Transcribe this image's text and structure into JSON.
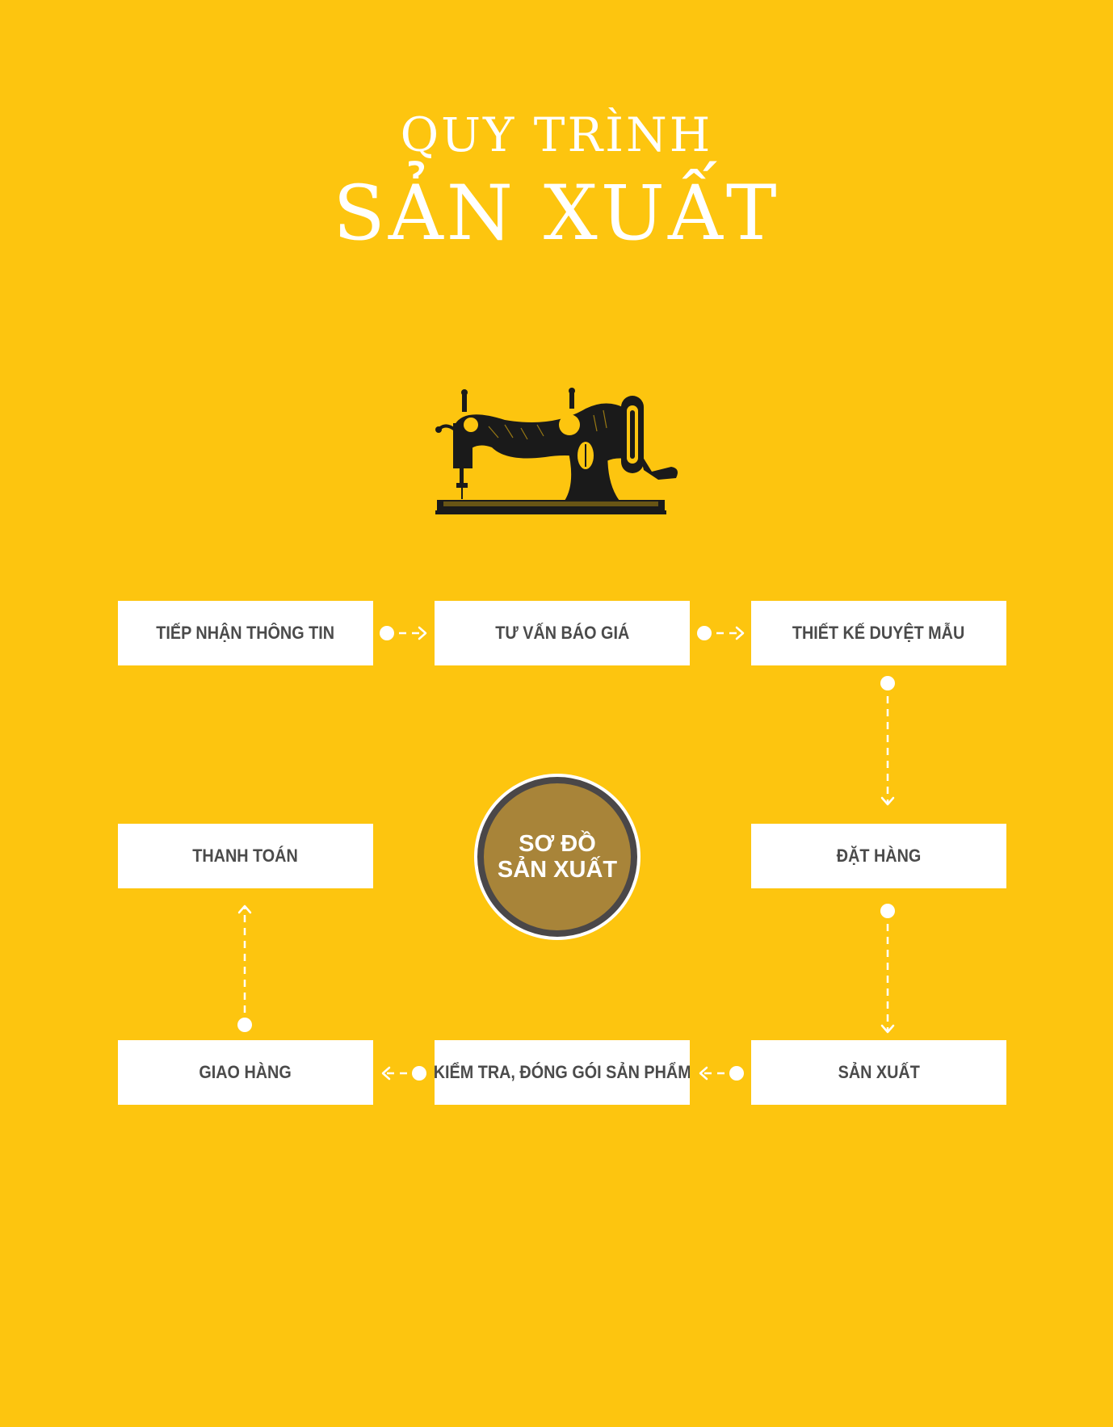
{
  "title": {
    "line1": "QUY TRÌNH",
    "line2": "SẢN XUẤT"
  },
  "center": {
    "line1": "SƠ ĐỒ",
    "line2": "SẢN XUẤT"
  },
  "steps": [
    "TIẾP NHẬN THÔNG TIN",
    "TƯ VẤN BÁO GIÁ",
    "THIẾT KẾ DUYỆT MẪU",
    "ĐẶT HÀNG",
    "SẢN XUẤT",
    "KIỂM TRA, ĐÓNG GÓI SẢN PHẨM",
    "GIAO HÀNG",
    "THANH TOÁN"
  ],
  "icons": {
    "illustration": "sewing-machine-icon"
  },
  "colors": {
    "background": "#FDC50F",
    "box": "#FFFFFF",
    "box_text": "#4B4B4B",
    "circle_fill": "#A88439",
    "circle_ring": "#4A4748",
    "connector": "#FFFFFF"
  }
}
